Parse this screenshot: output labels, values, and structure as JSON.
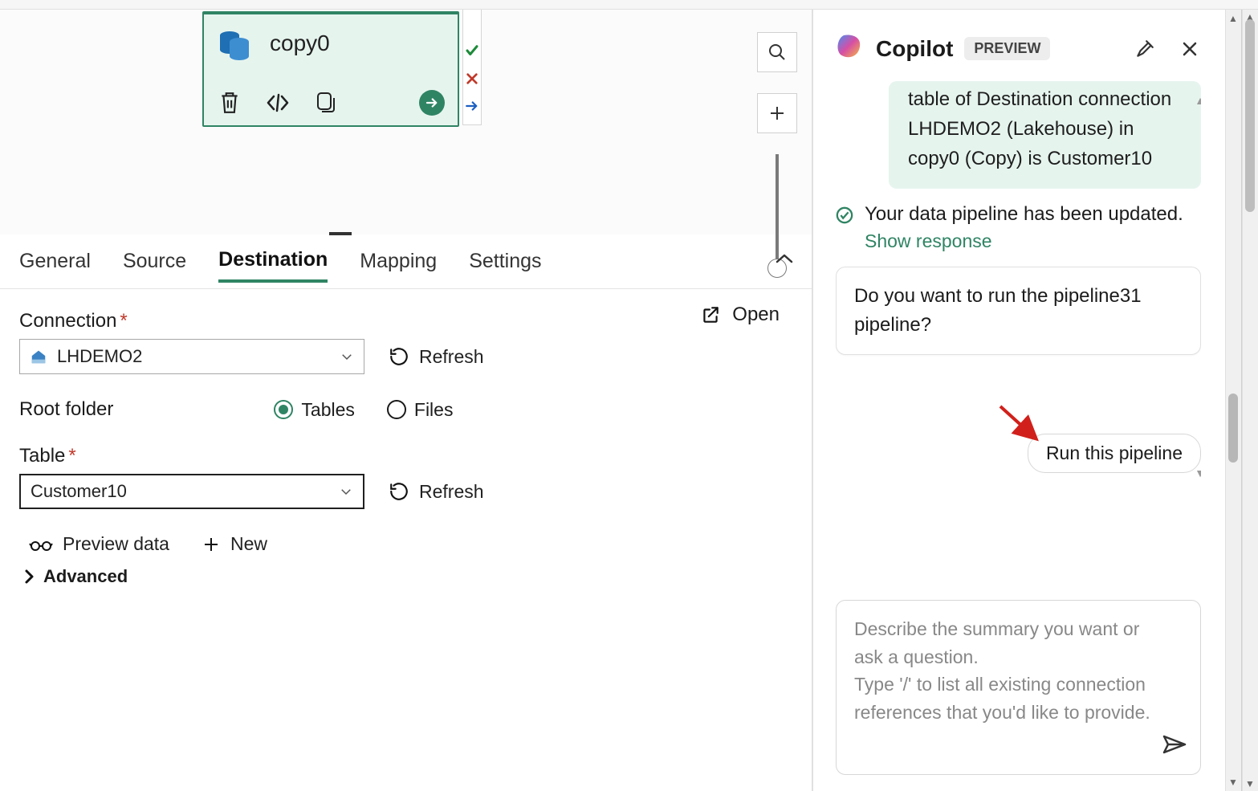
{
  "activity": {
    "title": "copy0",
    "statuses": [
      "success",
      "error",
      "skip"
    ]
  },
  "tabs": {
    "general": "General",
    "source": "Source",
    "destination": "Destination",
    "mapping": "Mapping",
    "settings": "Settings",
    "active": "destination"
  },
  "destination": {
    "connection_label": "Connection",
    "connection_value": "LHDEMO2",
    "refresh": "Refresh",
    "root_folder_label": "Root folder",
    "root_folder_options": {
      "tables": "Tables",
      "files": "Files"
    },
    "root_folder_selected": "tables",
    "table_label": "Table",
    "table_value": "Customer10",
    "preview_data": "Preview data",
    "new": "New",
    "advanced": "Advanced",
    "open": "Open"
  },
  "copilot": {
    "title": "Copilot",
    "preview": "PREVIEW",
    "green_message": "table of Destination connection LHDEMO2 (Lakehouse) in copy0 (Copy) is Customer10",
    "status_ok": "Your data pipeline has been updated.",
    "show_response": "Show response",
    "prompt_question": "Do you want to run the pipeline31 pipeline?",
    "run_button": "Run this pipeline",
    "composer_placeholder": "Describe the summary you want or ask a question.\nType '/' to list all existing connection references that you'd like to provide."
  }
}
